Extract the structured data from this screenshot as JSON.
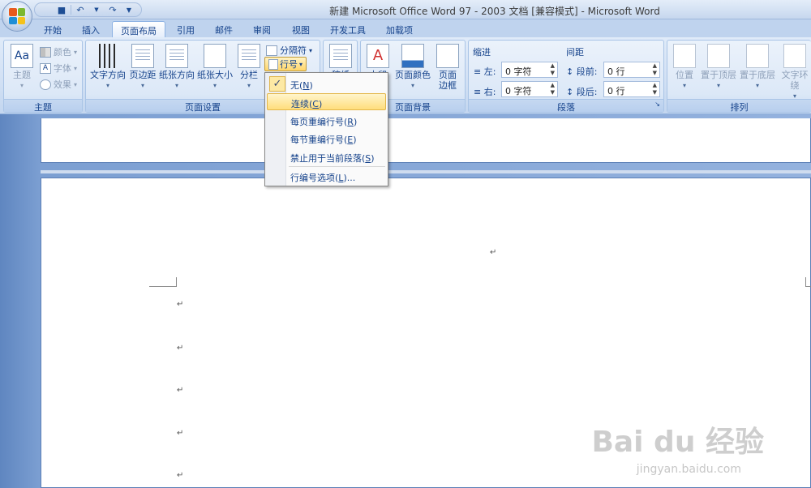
{
  "window": {
    "title": "新建 Microsoft Office Word 97 - 2003 文档 [兼容模式] - Microsoft Word"
  },
  "qat": {
    "save_icon": "save-icon",
    "undo_icon": "undo-icon",
    "redo_icon": "redo-icon",
    "customize_icon": "customize-qat-icon"
  },
  "tabs": [
    "开始",
    "插入",
    "页面布局",
    "引用",
    "邮件",
    "审阅",
    "视图",
    "开发工具",
    "加载项"
  ],
  "active_tab": "页面布局",
  "groups": {
    "theme": {
      "label": "主题",
      "theme_btn": "主题",
      "colors": "颜色",
      "fonts": "字体",
      "effects": "效果"
    },
    "page_setup": {
      "label": "页面设置",
      "text_direction": "文字方向",
      "margins": "页边距",
      "orientation": "纸张方向",
      "size": "纸张大小",
      "columns": "分栏",
      "breaks": "分隔符",
      "line_numbers": "行号"
    },
    "page_background": {
      "label": "页面背景",
      "watermark": "水印",
      "page_color": "页面颜色",
      "page_borders_1": "页面",
      "page_borders_2": "边框",
      "partial_left": "稿纸"
    },
    "paragraph": {
      "label": "段落",
      "indent_title": "缩进",
      "spacing_title": "间距",
      "left": "左:",
      "right": "右:",
      "before": "段前:",
      "after": "段后:",
      "left_value": "0 字符",
      "right_value": "0 字符",
      "before_value": "0 行",
      "after_value": "0 行"
    },
    "arrange": {
      "label": "排列",
      "position": "位置",
      "bring_front": "置于顶层",
      "send_back": "置于底层",
      "wrap": "文字环绕"
    }
  },
  "menu": {
    "items": [
      {
        "label": "无(",
        "key": "N",
        "close": ")",
        "checked": true
      },
      {
        "label": "连续(",
        "key": "C",
        "close": ")",
        "checked": false,
        "hover": true
      },
      {
        "label": "每页重编行号(",
        "key": "R",
        "close": ")",
        "checked": false
      },
      {
        "label": "每节重编行号(",
        "key": "E",
        "close": ")",
        "checked": false
      },
      {
        "label": "禁止用于当前段落(",
        "key": "S",
        "close": ")",
        "checked": false
      },
      {
        "label": "行编号选项(",
        "key": "L",
        "close": ")...",
        "checked": false
      }
    ],
    "check_glyph": "✓"
  },
  "document": {
    "paragraph_mark": "↵"
  },
  "watermark": {
    "brand": "Bai du 经验",
    "url": "jingyan.baidu.com"
  }
}
